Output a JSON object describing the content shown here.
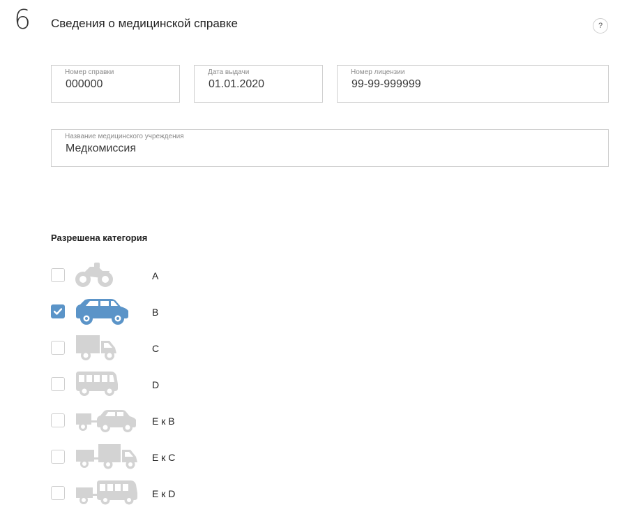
{
  "section": {
    "step": "6",
    "title": "Сведения о медицинской справке",
    "help": "?"
  },
  "fields": {
    "number": {
      "label": "Номер справки",
      "value": "000000"
    },
    "date": {
      "label": "Дата выдачи",
      "value": "01.01.2020"
    },
    "license": {
      "label": "Номер лицензии",
      "value": "99-99-999999"
    },
    "organization": {
      "label": "Название медицинского учреждения",
      "value": "Медкомиссия"
    }
  },
  "categories": {
    "title": "Разрешена категория",
    "items": [
      {
        "label": "A",
        "icon": "motorcycle-icon",
        "checked": false
      },
      {
        "label": "B",
        "icon": "car-icon",
        "checked": true
      },
      {
        "label": "C",
        "icon": "truck-icon",
        "checked": false
      },
      {
        "label": "D",
        "icon": "bus-icon",
        "checked": false
      },
      {
        "label": "E к B",
        "icon": "trailer-car-icon",
        "checked": false
      },
      {
        "label": "E к C",
        "icon": "trailer-truck-icon",
        "checked": false
      },
      {
        "label": "E к D",
        "icon": "trailer-bus-icon",
        "checked": false
      }
    ]
  },
  "colors": {
    "accent": "#5b94c8",
    "inactive_icon": "#d3d3d3",
    "border": "#cfcfcf"
  }
}
